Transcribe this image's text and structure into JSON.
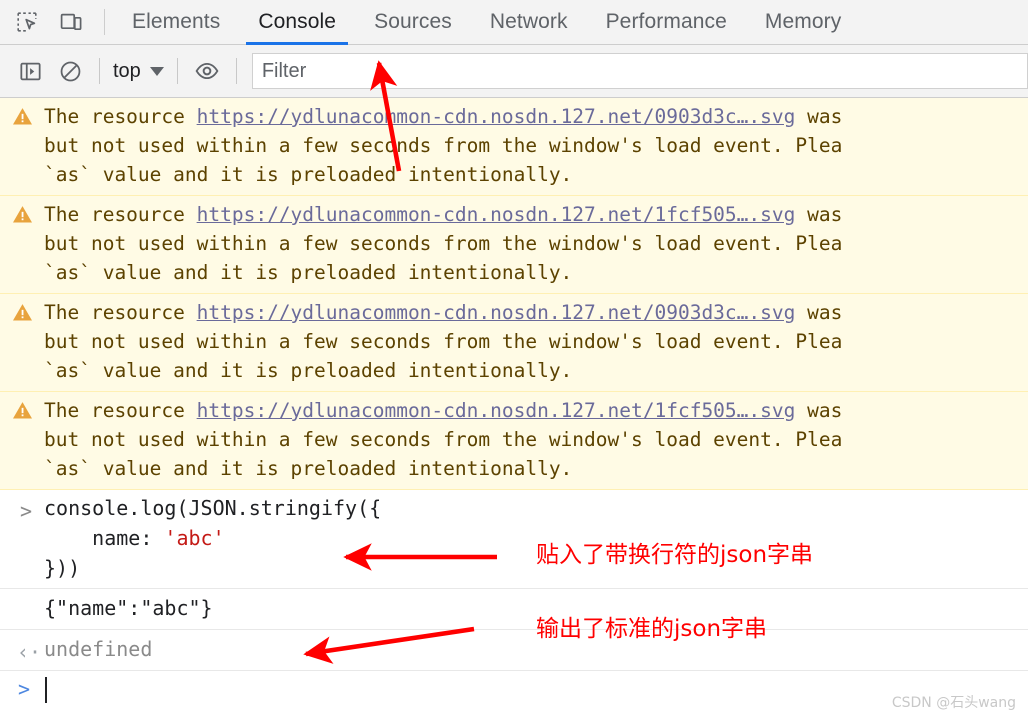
{
  "devtools": {
    "toolbar_icons": [
      {
        "name": "inspect-element-icon",
        "label": "Inspect element"
      },
      {
        "name": "device-toolbar-icon",
        "label": "Toggle device toolbar"
      }
    ],
    "tabs": [
      {
        "label": "Elements",
        "active": false
      },
      {
        "label": "Console",
        "active": true
      },
      {
        "label": "Sources",
        "active": false
      },
      {
        "label": "Network",
        "active": false
      },
      {
        "label": "Performance",
        "active": false
      },
      {
        "label": "Memory",
        "active": false
      }
    ],
    "active_tab": "Console",
    "accent_color": "#1a73e8"
  },
  "console_toolbar": {
    "sidebar_toggle": "sidebar-toggle-icon",
    "clear_console": "clear-console-icon",
    "context_selector": {
      "value": "top",
      "caret": "chevron-down-icon"
    },
    "live_expression": "eye-icon",
    "filter": {
      "value": "",
      "placeholder": "Filter"
    }
  },
  "messages": [
    {
      "type": "warning",
      "icon": "warning-triangle-icon",
      "prefix": "The resource ",
      "url": "https://ydlunacommon-cdn.nosdn.127.net/0903d3c….svg",
      "line1_suffix": " was",
      "line2": "but not used within a few seconds from the window's load event. Plea",
      "line3": "`as` value and it is preloaded intentionally."
    },
    {
      "type": "warning",
      "icon": "warning-triangle-icon",
      "prefix": "The resource ",
      "url": "https://ydlunacommon-cdn.nosdn.127.net/1fcf505….svg",
      "line1_suffix": " was",
      "line2": "but not used within a few seconds from the window's load event. Plea",
      "line3": "`as` value and it is preloaded intentionally."
    },
    {
      "type": "warning",
      "icon": "warning-triangle-icon",
      "prefix": "The resource ",
      "url": "https://ydlunacommon-cdn.nosdn.127.net/0903d3c….svg",
      "line1_suffix": " was",
      "line2": "but not used within a few seconds from the window's load event. Plea",
      "line3": "`as` value and it is preloaded intentionally."
    },
    {
      "type": "warning",
      "icon": "warning-triangle-icon",
      "prefix": "The resource ",
      "url": "https://ydlunacommon-cdn.nosdn.127.net/1fcf505….svg",
      "line1_suffix": " was",
      "line2": "but not used within a few seconds from the window's load event. Plea",
      "line3": "`as` value and it is preloaded intentionally."
    }
  ],
  "command": {
    "prompt_marker": ">",
    "line1": "console.log(JSON.stringify({",
    "line2_prefix": "    name: ",
    "line2_string": "'abc'",
    "line3": "}))"
  },
  "log_output": {
    "text": "{\"name\":\"abc\"}"
  },
  "result": {
    "prompt_marker": "‹·",
    "value": "undefined"
  },
  "input_prompt": {
    "marker": ">",
    "value": ""
  },
  "annotations": [
    {
      "name": "annotation-filter-arrow",
      "kind": "arrow",
      "text": ""
    },
    {
      "name": "annotation-pasted-json",
      "kind": "label",
      "text": "贴入了带换行符的json字串"
    },
    {
      "name": "annotation-output-json",
      "kind": "label",
      "text": "输出了标准的json字串"
    }
  ],
  "watermark": {
    "text": "CSDN @石头wang"
  },
  "colors": {
    "warning_bg": "#fffbe5",
    "warning_text": "#5c4200",
    "annotation": "#ff0000",
    "string_token": "#c41a16"
  }
}
